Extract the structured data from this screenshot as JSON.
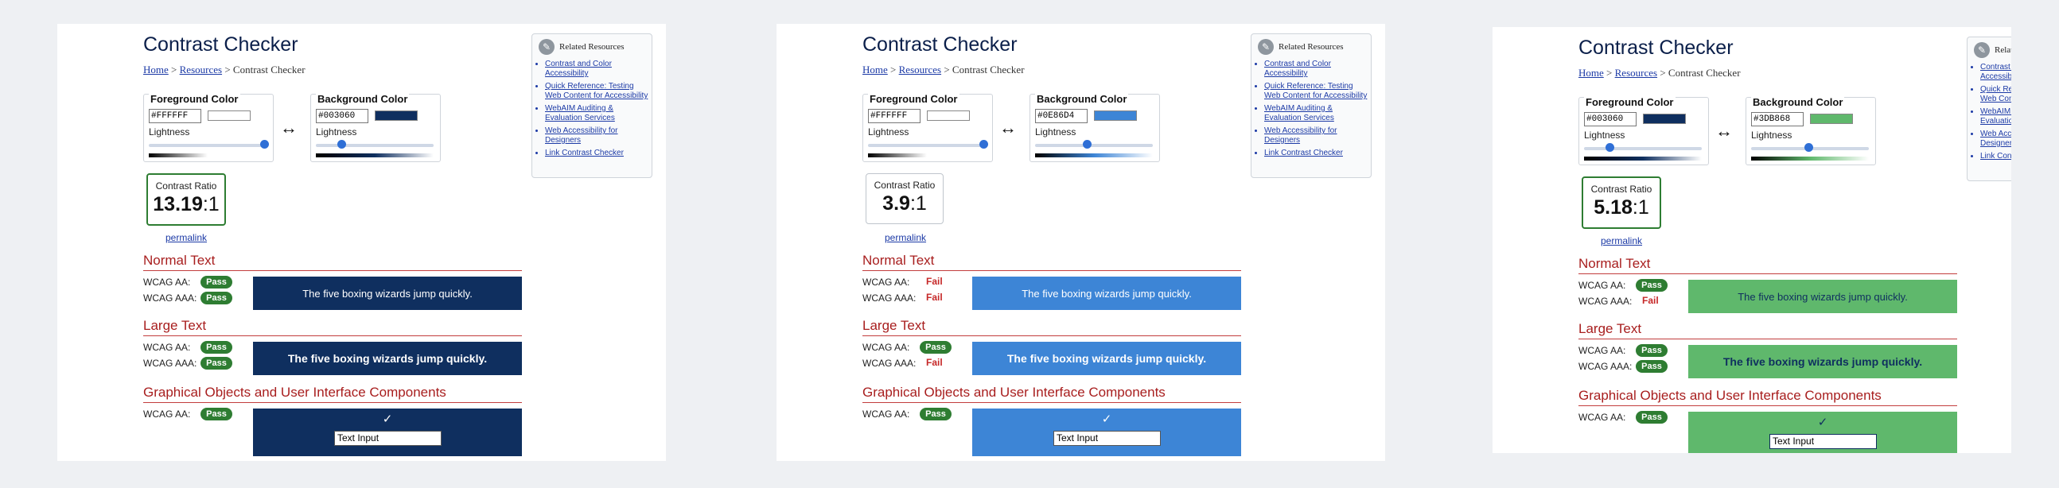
{
  "page": {
    "title": "Contrast Checker",
    "breadcrumb": [
      "Home",
      "Resources",
      "Contrast Checker"
    ],
    "sep": ">"
  },
  "labels": {
    "foreground": "Foreground Color",
    "background": "Background Color",
    "lightness": "Lightness",
    "swap": "↔",
    "ratio": "Contrast Ratio",
    "ratio_suffix": ":1",
    "permalink": "permalink",
    "normal": "Normal Text",
    "large": "Large Text",
    "graphical": "Graphical Objects and User Interface Components",
    "aa": "WCAG AA:",
    "aaa": "WCAG AAA:",
    "sample": "The five boxing wizards jump quickly.",
    "check": "✓",
    "text_input": "Text Input"
  },
  "related": {
    "title": "Related Resources",
    "links": [
      "Contrast and Color Accessibility",
      "Quick Reference: Testing Web Content for Accessibility",
      "WebAIM Auditing & Evaluation Services",
      "Web Accessibility for Designers",
      "Link Contrast Checker"
    ]
  },
  "panels": [
    {
      "fg": "#FFFFFF",
      "bg": "#003060",
      "fg_color": "#ffffff",
      "bg_color": "#0f2f5f",
      "ratio": "13.19",
      "fg_lightness": 1.0,
      "bg_lightness": 0.19,
      "results": {
        "normal_aa": "Pass",
        "normal_aaa": "Pass",
        "large_aa": "Pass",
        "large_aaa": "Pass",
        "graphical_aa": "Pass"
      }
    },
    {
      "fg": "#FFFFFF",
      "bg": "#0E86D4",
      "fg_color": "#ffffff",
      "bg_color": "#3d85d6",
      "ratio": "3.9",
      "fg_lightness": 1.0,
      "bg_lightness": 0.43,
      "results": {
        "normal_aa": "Fail",
        "normal_aaa": "Fail",
        "large_aa": "Pass",
        "large_aaa": "Fail",
        "graphical_aa": "Pass"
      }
    },
    {
      "fg": "#003060",
      "bg": "#3DB868",
      "fg_color": "#0f2f5f",
      "bg_color": "#5fb86c",
      "ratio": "5.18",
      "fg_lightness": 0.19,
      "bg_lightness": 0.48,
      "results": {
        "normal_aa": "Pass",
        "normal_aaa": "Fail",
        "large_aa": "Pass",
        "large_aaa": "Pass",
        "graphical_aa": "Pass"
      }
    }
  ],
  "colors": {
    "pass": "#2e7d32",
    "fail": "#c62828",
    "heading": "#a81e1e",
    "link": "#1c3aa6"
  }
}
